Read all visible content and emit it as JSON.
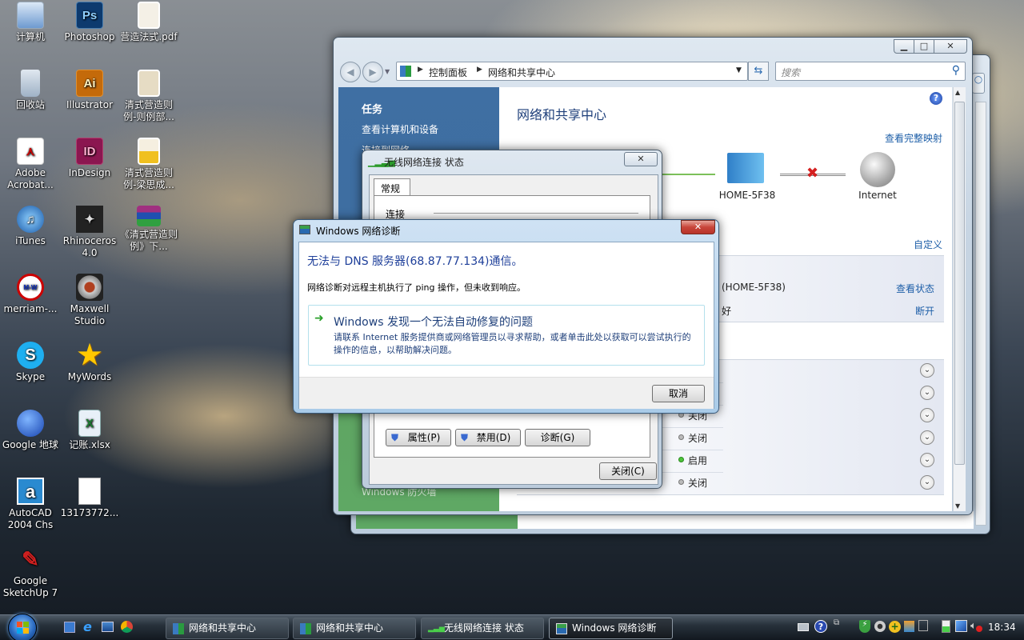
{
  "desktop": {
    "icons": [
      {
        "label": "计算机",
        "icon": "computer-icon"
      },
      {
        "label": "Photoshop",
        "icon": "photoshop-icon",
        "glyph": "Ps"
      },
      {
        "label": "营造法式.pdf",
        "icon": "pdf-document-icon"
      },
      {
        "label": "回收站",
        "icon": "recycle-bin-icon"
      },
      {
        "label": "Illustrator",
        "icon": "illustrator-icon",
        "glyph": "Ai"
      },
      {
        "label": "清式营造则例-则例部...",
        "icon": "document-icon"
      },
      {
        "label": "Adobe Acrobat...",
        "icon": "acrobat-icon"
      },
      {
        "label": "InDesign",
        "icon": "indesign-icon",
        "glyph": "ID"
      },
      {
        "label": "清式营造则例-梁思成...",
        "icon": "document-icon"
      },
      {
        "label": "iTunes",
        "icon": "itunes-icon"
      },
      {
        "label": "Rhinoceros 4.0",
        "icon": "rhinoceros-icon"
      },
      {
        "label": "《清式营造则例》下...",
        "icon": "winrar-archive-icon"
      },
      {
        "label": "merriam-...",
        "icon": "merriam-webster-icon"
      },
      {
        "label": "Maxwell Studio",
        "icon": "maxwell-icon"
      },
      {
        "label": "Skype",
        "icon": "skype-icon",
        "glyph": "S"
      },
      {
        "label": "MyWords",
        "icon": "star-icon"
      },
      {
        "label": "Google 地球",
        "icon": "google-earth-icon"
      },
      {
        "label": "记账.xlsx",
        "icon": "excel-icon"
      },
      {
        "label": "AutoCAD 2004 Chs",
        "icon": "autocad-icon",
        "glyph": "a"
      },
      {
        "label": "13173772...",
        "icon": "document-icon"
      },
      {
        "label": "Google SketchUp 7",
        "icon": "sketchup-icon"
      }
    ]
  },
  "network_center": {
    "breadcrumb": [
      "控制面板",
      "网络和共享中心"
    ],
    "search_placeholder": "搜索",
    "sidebar": {
      "heading": "任务",
      "items": [
        "查看计算机和设备",
        "连接到网络"
      ],
      "footer": "Windows 防火墙"
    },
    "title": "网络和共享中心",
    "view_full_map": "查看完整映射",
    "map": {
      "node1": "HOME-5F38",
      "node2": "Internet",
      "link_status": "disconnected"
    },
    "customize": "自定义",
    "connection": {
      "name": "(HOME-5F38)",
      "signal": "好",
      "view_status": "查看状态",
      "disconnect": "断开"
    },
    "sharing_rows": [
      {
        "status": "",
        "state": "off"
      },
      {
        "status": "",
        "state": "off"
      },
      {
        "status": "关闭",
        "state": "off"
      },
      {
        "status": "关闭",
        "state": "off"
      },
      {
        "status": "启用",
        "state": "on"
      },
      {
        "status": "关闭",
        "state": "off"
      }
    ]
  },
  "wireless_status": {
    "title": "无线网络连接 状态",
    "tab": "常规",
    "section": "连接",
    "buttons": {
      "properties": "属性(P)",
      "disable": "禁用(D)",
      "diagnose": "诊断(G)",
      "close": "关闭(C)"
    }
  },
  "diagnostics": {
    "title": "Windows 网络诊断",
    "heading": "无法与 DNS 服务器(68.87.77.134)通信。",
    "description": "网络诊断对远程主机执行了 ping 操作，但未收到响应。",
    "option_title": "Windows 发现一个无法自动修复的问题",
    "option_desc": "请联系 Internet 服务提供商或网络管理员以寻求帮助，或者单击此处以获取可以尝试执行的操作的信息，以帮助解决问题。",
    "cancel": "取消"
  },
  "taskbar": {
    "items": [
      {
        "label": "网络和共享中心",
        "active": false
      },
      {
        "label": "网络和共享中心",
        "active": false
      },
      {
        "label": "无线网络连接 状态",
        "active": false
      },
      {
        "label": "Windows 网络诊断",
        "active": true
      }
    ],
    "clock": "18:34"
  }
}
